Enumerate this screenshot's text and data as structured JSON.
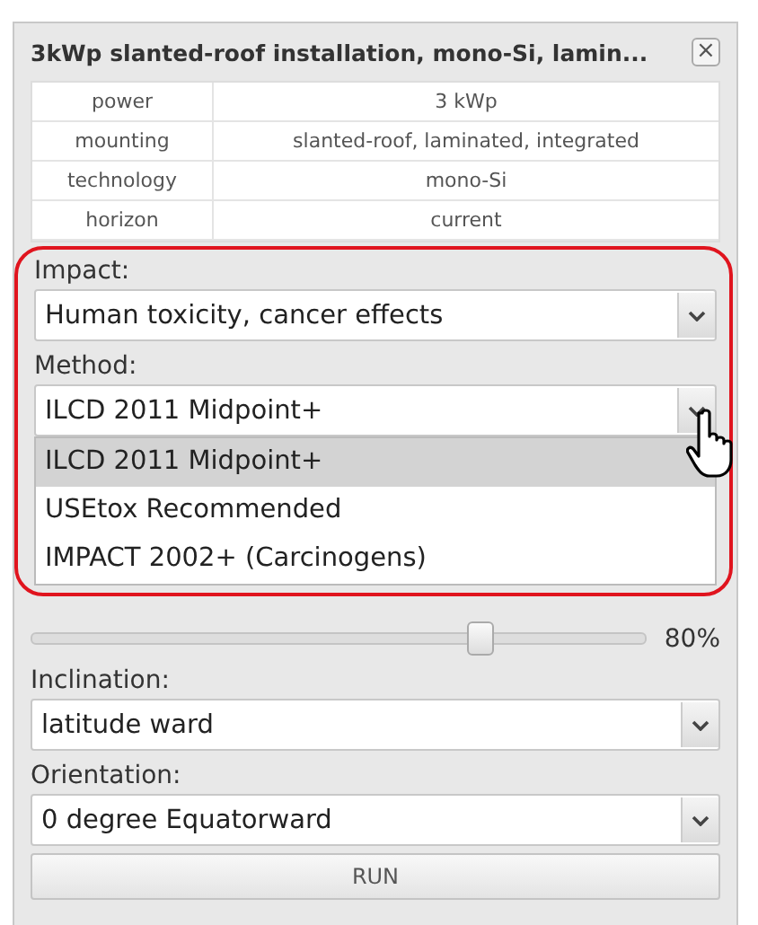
{
  "window": {
    "title": "3kWp slanted-roof installation, mono-Si, lamin...",
    "close": "×"
  },
  "properties": [
    {
      "name": "power",
      "value": "3 kWp"
    },
    {
      "name": "mounting",
      "value": "slanted-roof, laminated, integrated"
    },
    {
      "name": "technology",
      "value": "mono-Si"
    },
    {
      "name": "horizon",
      "value": "current"
    }
  ],
  "impact": {
    "label": "Impact:",
    "value": "Human toxicity, cancer effects"
  },
  "method": {
    "label": "Method:",
    "value": "ILCD 2011 Midpoint+",
    "expanded": true,
    "options": [
      {
        "label": "ILCD 2011 Midpoint+",
        "selected": true
      },
      {
        "label": "USEtox Recommended",
        "selected": false
      },
      {
        "label": "IMPACT 2002+ (Carcinogens)",
        "selected": false
      }
    ]
  },
  "slider": {
    "level": 0.73,
    "reading": "80%"
  },
  "inclination": {
    "label": "Inclination:",
    "value": "latitude ward"
  },
  "orientation": {
    "label": "Orientation:",
    "value": "0 degree Equatorward"
  },
  "run_button": "RUN"
}
